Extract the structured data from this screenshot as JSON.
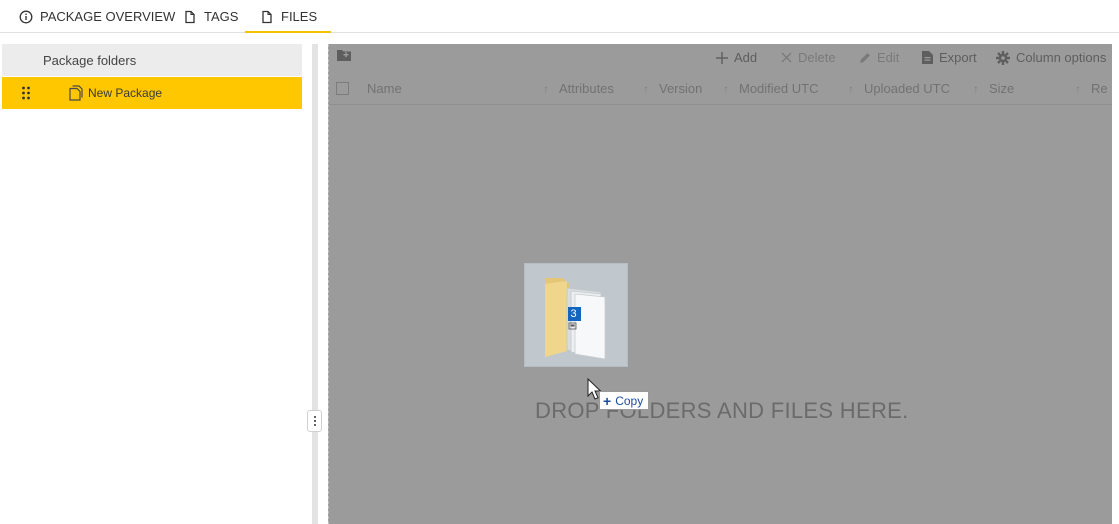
{
  "tabs": [
    {
      "label": "PACKAGE OVERVIEW",
      "icon": "info-icon"
    },
    {
      "label": "TAGS",
      "icon": "document-icon"
    },
    {
      "label": "FILES",
      "icon": "document-icon",
      "active": true
    }
  ],
  "left_panel": {
    "header": "Package folders",
    "items": [
      {
        "label": "New Package",
        "icon": "package-copy-icon",
        "selected": true
      }
    ]
  },
  "toolbar": {
    "new_folder_icon": "new-folder-icon",
    "add": "Add",
    "delete": "Delete",
    "edit": "Edit",
    "export": "Export",
    "column_options": "Column options"
  },
  "grid": {
    "columns": [
      "Name",
      "Attributes",
      "Version",
      "Modified UTC",
      "Uploaded UTC",
      "Size",
      "Re"
    ]
  },
  "drop_zone": {
    "text": "DROP FOLDERS AND FILES HERE."
  },
  "drag": {
    "count": "3",
    "tooltip": "Copy"
  },
  "colors": {
    "accent": "#fec700",
    "overlay": "#9b9b9b"
  }
}
